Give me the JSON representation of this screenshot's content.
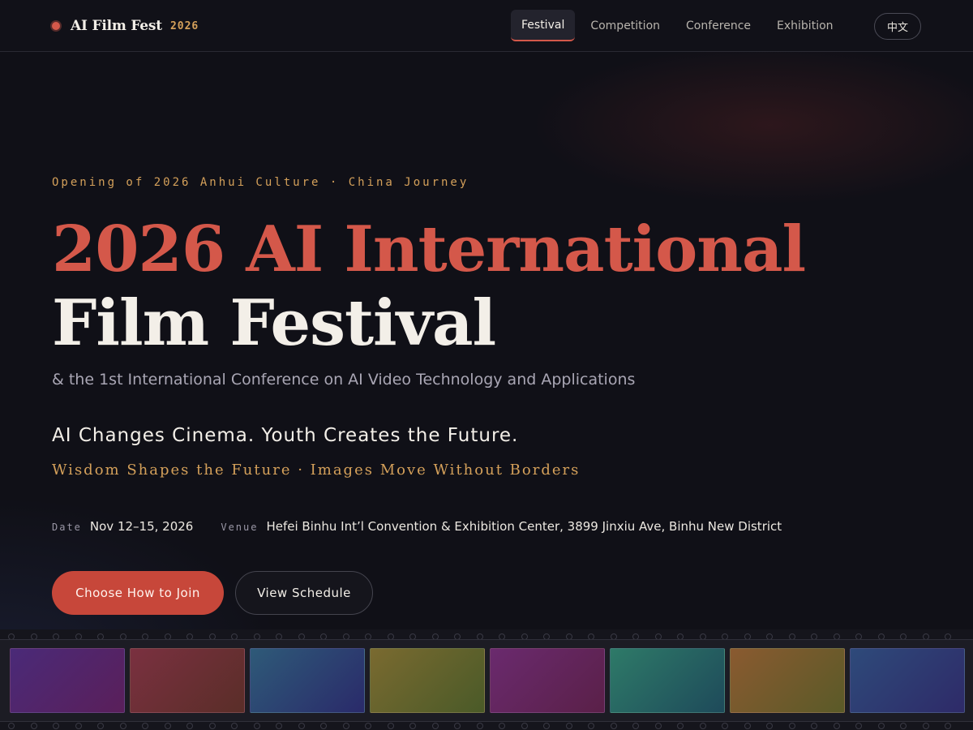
{
  "header": {
    "brand_name": "AI Film Fest",
    "brand_year": "2026",
    "nav": [
      {
        "label": "Festival",
        "active": true
      },
      {
        "label": "Competition",
        "active": false
      },
      {
        "label": "Conference",
        "active": false
      },
      {
        "label": "Exhibition",
        "active": false
      }
    ],
    "language_toggle": "中文"
  },
  "hero": {
    "eyebrow": "Opening of 2026 Anhui Culture · China Journey",
    "title_line1": "2026 AI International",
    "title_line2": "Film Festival",
    "subtitle": "& the 1st International Conference on AI Video Technology and Applications",
    "tagline": "AI Changes Cinema. Youth Creates the Future.",
    "motto": "Wisdom Shapes the Future · Images Move Without Borders",
    "date_label": "Date",
    "date_value": "Nov 12–15, 2026",
    "venue_label": "Venue",
    "venue_value": "Hefei Binhu Int’l Convention & Exhibition Center, 3899 Jinxiu Ave, Binhu New District",
    "primary_cta": "Choose How to Join",
    "secondary_cta": "View Schedule"
  },
  "colors": {
    "accent_red": "#d4584a",
    "accent_gold": "#d4a05a",
    "background": "#101017"
  },
  "filmstrip": {
    "frames": [
      {
        "from": "#4a2a78",
        "to": "#5a1f5a"
      },
      {
        "from": "#7a3040",
        "to": "#5a2e28"
      },
      {
        "from": "#2e5a78",
        "to": "#2a2a6a"
      },
      {
        "from": "#7a6a30",
        "to": "#4a5a28"
      },
      {
        "from": "#6a2a6e",
        "to": "#5a2048"
      },
      {
        "from": "#2e7a68",
        "to": "#1e4a5a"
      },
      {
        "from": "#8a5a30",
        "to": "#5a5a28"
      },
      {
        "from": "#2e4a7a",
        "to": "#2e2a68"
      }
    ]
  }
}
